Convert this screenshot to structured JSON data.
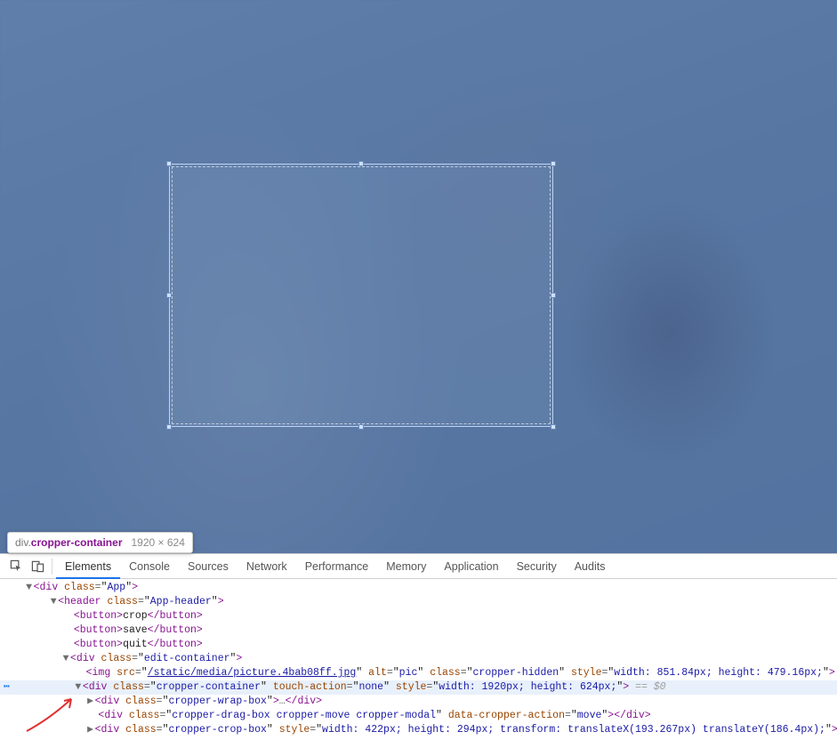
{
  "tooltip": {
    "tag": "div",
    "classname": "cropper-container",
    "dimensions": "1920 × 624"
  },
  "devtools": {
    "tabs": {
      "elements": "Elements",
      "console": "Console",
      "sources": "Sources",
      "network": "Network",
      "performance": "Performance",
      "memory": "Memory",
      "application": "Application",
      "security": "Security",
      "audits": "Audits"
    },
    "active_tab": "elements"
  },
  "dom": {
    "l0": {
      "open": "<div class=\"App\">",
      "cls": "App"
    },
    "l1": {
      "open": "<header class=\"App-header\">",
      "cls": "App-header"
    },
    "btn_crop": "crop",
    "btn_save": "save",
    "btn_quit": "quit",
    "l2": {
      "open": "<div class=\"edit-container\">",
      "cls": "edit-container"
    },
    "img": {
      "src": "/static/media/picture.4bab08ff.jpg",
      "alt": "pic",
      "cls": "cropper-hidden",
      "style": "width: 851.84px; height: 479.16px;"
    },
    "l3": {
      "cls": "cropper-container",
      "touch": "none",
      "style": "width: 1920px; height: 624px;",
      "sel": " == $0"
    },
    "l4": {
      "cls": "cropper-wrap-box"
    },
    "l5": {
      "cls": "cropper-drag-box cropper-move cropper-modal",
      "action": "move"
    },
    "l6": {
      "cls": "cropper-crop-box",
      "style": "width: 422px; height: 294px; transform: translateX(193.267px) translateY(186.4px);"
    }
  }
}
